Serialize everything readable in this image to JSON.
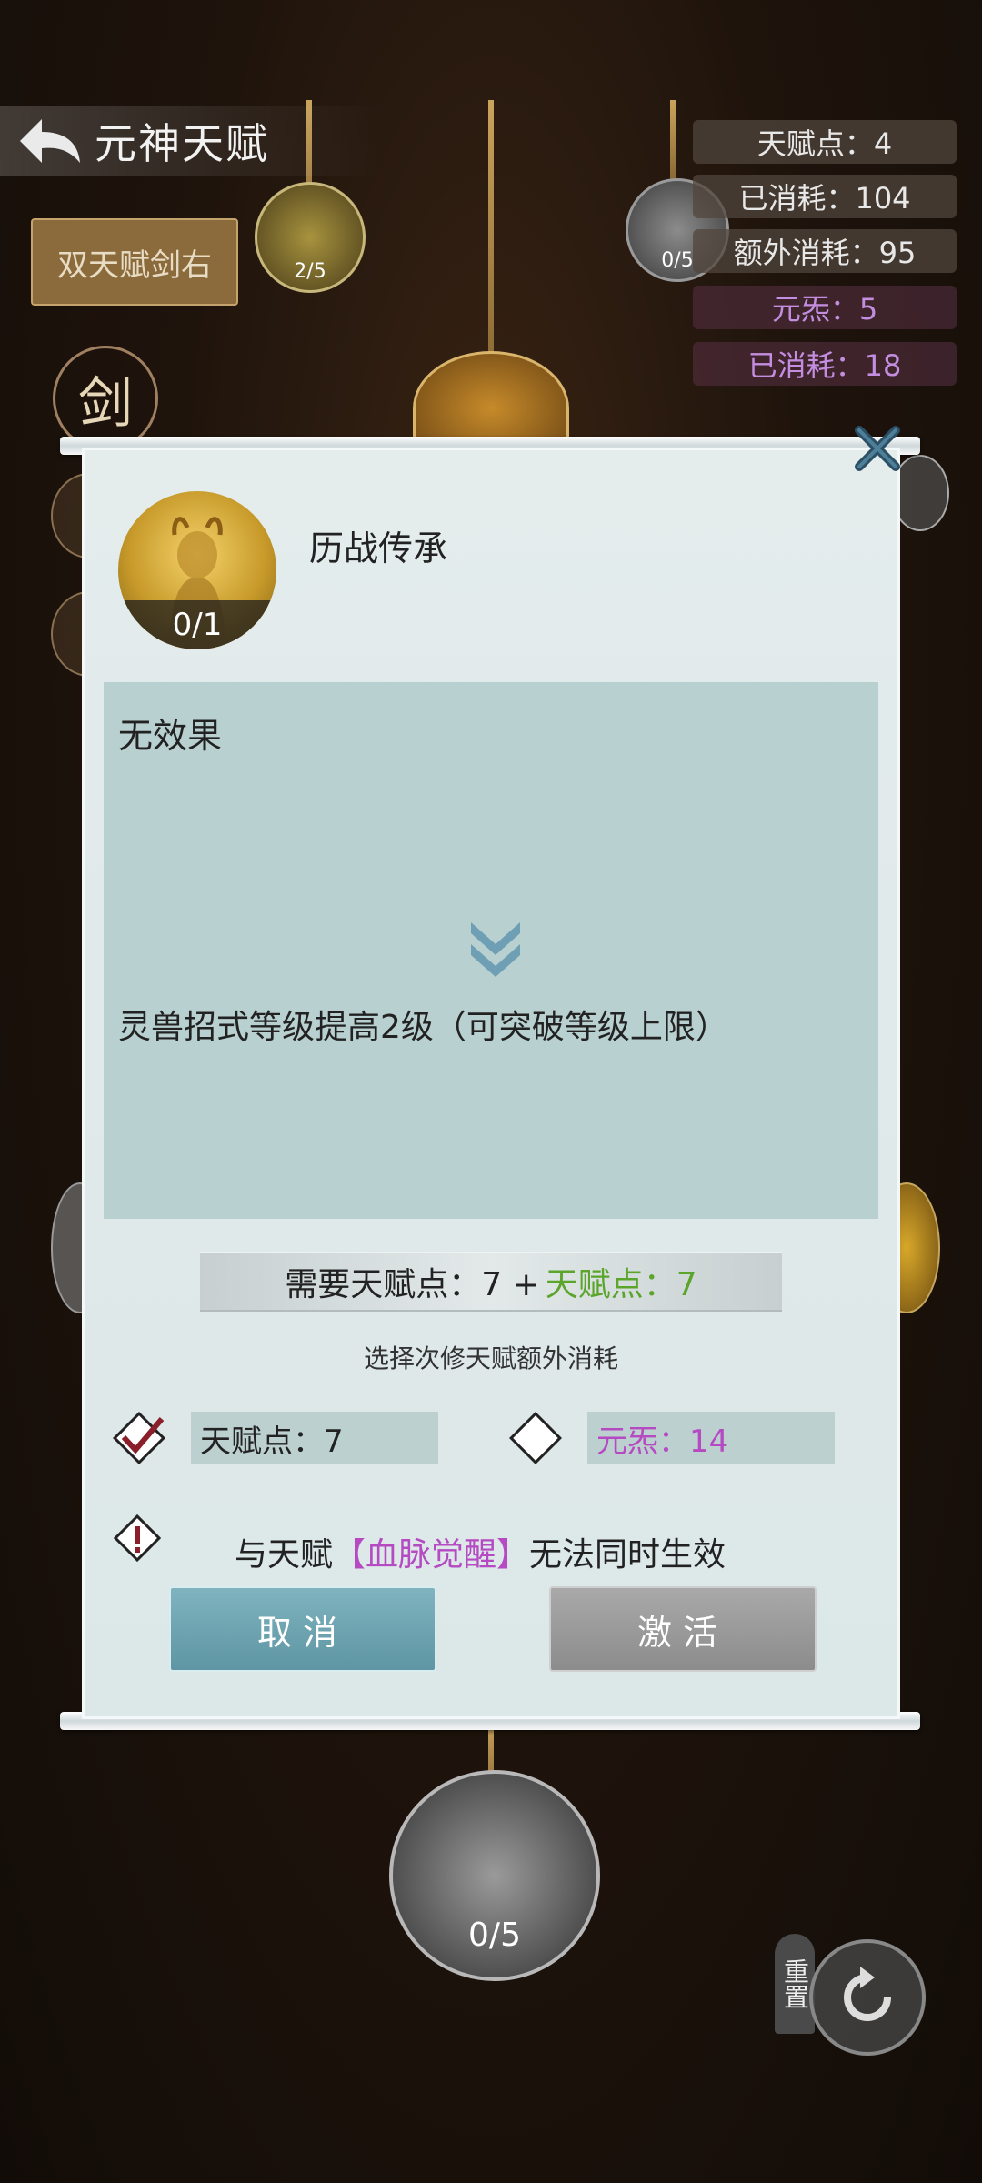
{
  "header": {
    "title": "元神天赋",
    "dual_button": "双天赋剑右",
    "sword_char": "剑"
  },
  "stats": {
    "talent_points": "天赋点：4",
    "consumed": "已消耗：104",
    "extra_consumed": "额外消耗：95",
    "yuansha": "元炁：5",
    "yuansha_consumed": "已消耗：18"
  },
  "nodes": {
    "top_left_progress": "2/5",
    "top_right_progress": "0/5",
    "bottom_progress": "0/5"
  },
  "modal": {
    "talent_name": "历战传承",
    "avatar_progress": "0/1",
    "current_effect": "无效果",
    "next_effect": "灵兽招式等级提高2级（可突破等级上限）",
    "need_label": "需要天赋点：7 +",
    "need_green": "天赋点：7",
    "choose_hint": "选择次修天赋额外消耗",
    "option_talent": "天赋点：7",
    "option_yuansha": "元炁：14",
    "warn_prefix": "与天赋",
    "warn_talent": "【血脉觉醒】",
    "warn_suffix": "无法同时生效",
    "cancel": "取消",
    "activate": "激活"
  },
  "reset_label": "重置",
  "colors": {
    "green": "#5ba52c",
    "purple": "#b54ac2",
    "accent": "#5e96a3"
  }
}
